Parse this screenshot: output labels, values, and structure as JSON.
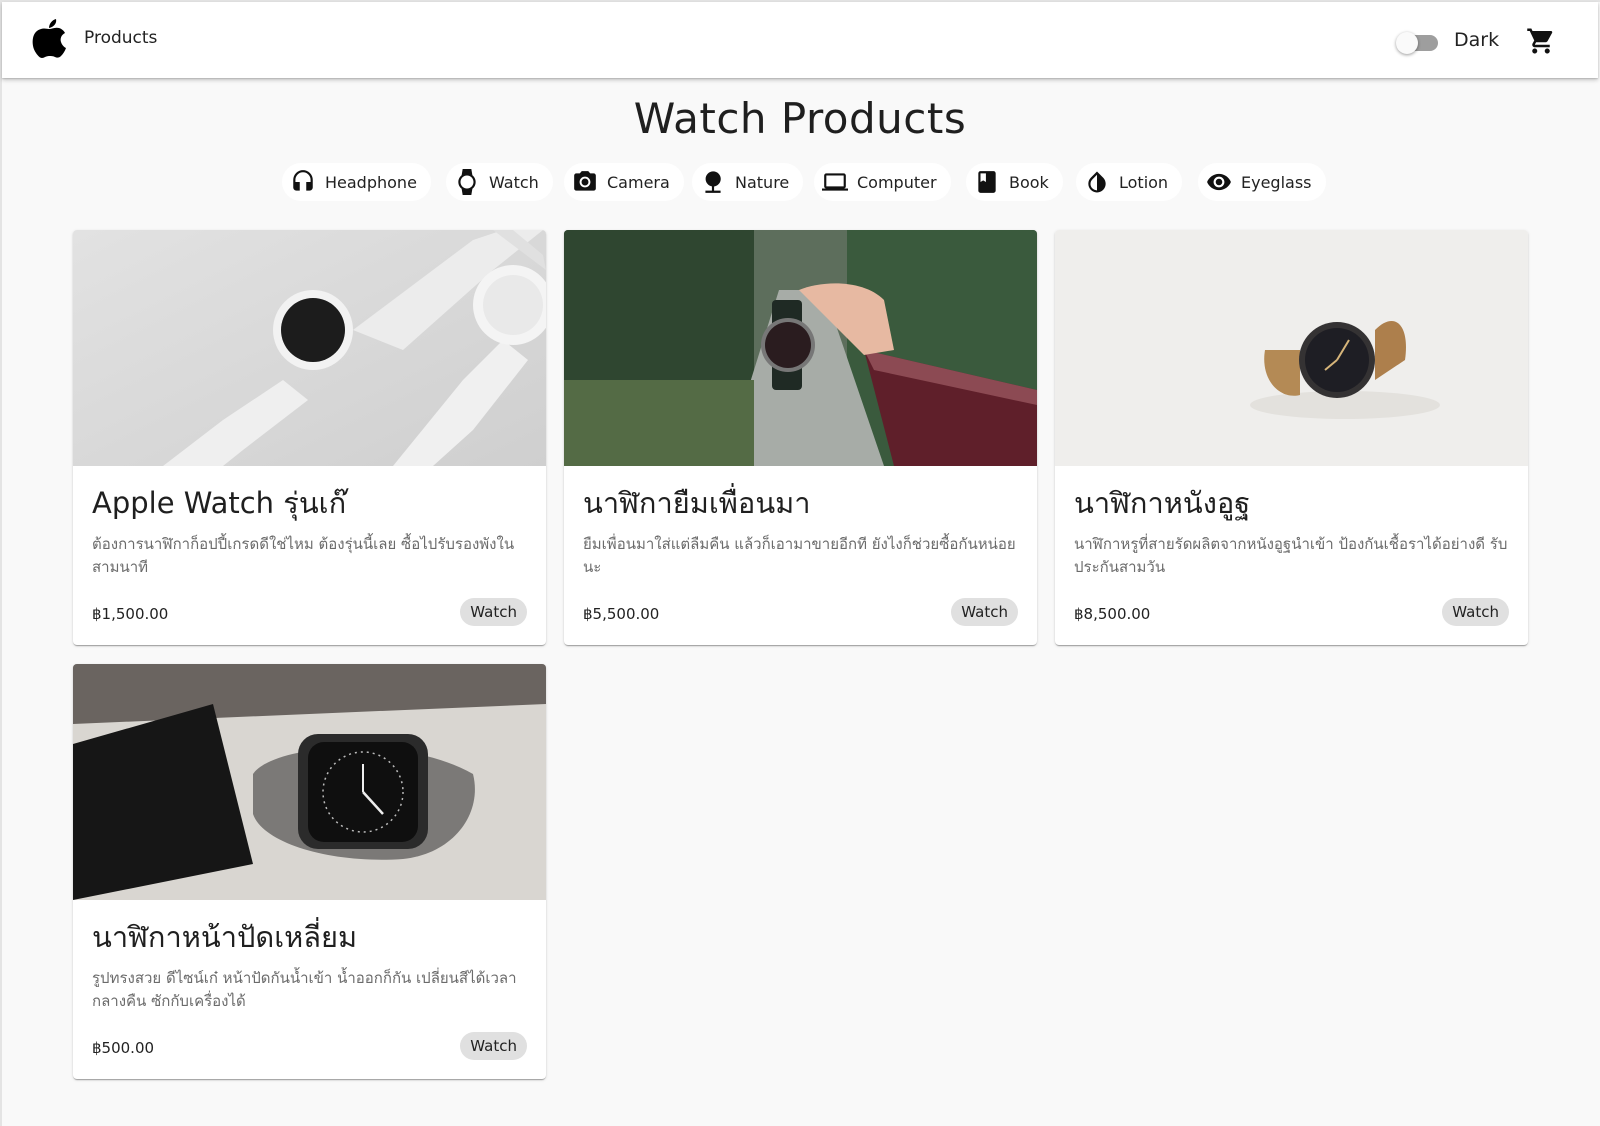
{
  "header": {
    "brand": "Products",
    "dark_mode_label": "Dark",
    "dark_mode_on": false
  },
  "page": {
    "title": "Watch Products"
  },
  "categories": [
    {
      "label": "Headphone",
      "icon": "headphone-icon"
    },
    {
      "label": "Watch",
      "icon": "watch-icon"
    },
    {
      "label": "Camera",
      "icon": "camera-icon"
    },
    {
      "label": "Nature",
      "icon": "nature-icon"
    },
    {
      "label": "Computer",
      "icon": "computer-icon"
    },
    {
      "label": "Book",
      "icon": "book-icon"
    },
    {
      "label": "Lotion",
      "icon": "lotion-icon"
    },
    {
      "label": "Eyeglass",
      "icon": "eyeglass-icon"
    }
  ],
  "products": [
    {
      "title": "Apple Watch รุ่นเก๊",
      "description": "ต้องการนาฬิกาก็อปปี้เกรดดีใช่ไหม ต้องรุ่นนี้เลย ซื้อไปรับรองพังในสามนาที",
      "price": "฿1,500.00",
      "tag": "Watch"
    },
    {
      "title": "นาฬิกายืมเพื่อนมา",
      "description": "ยืมเพื่อนมาใส่แต่ลืมคืน แล้วก็เอามาขายอีกที ยังไงก็ช่วยซื้อกันหน่อยนะ",
      "price": "฿5,500.00",
      "tag": "Watch"
    },
    {
      "title": "นาฬิกาหนังอูฐ",
      "description": "นาฬิกาหรูที่สายรัดผลิตจากหนังอูฐนำเข้า ป้องกันเชื้อราได้อย่างดี รับประกันสามวัน",
      "price": "฿8,500.00",
      "tag": "Watch"
    },
    {
      "title": "นาฬิกาหน้าปัดเหลี่ยม",
      "description": "รูปทรงสวย ดีไซน์เก๋ หน้าปัดกันน้ำเข้า น้ำออกก็กัน เปลี่ยนสีได้เวลากลางคืน ซักกับเครื่องได้",
      "price": "฿500.00",
      "tag": "Watch"
    }
  ]
}
